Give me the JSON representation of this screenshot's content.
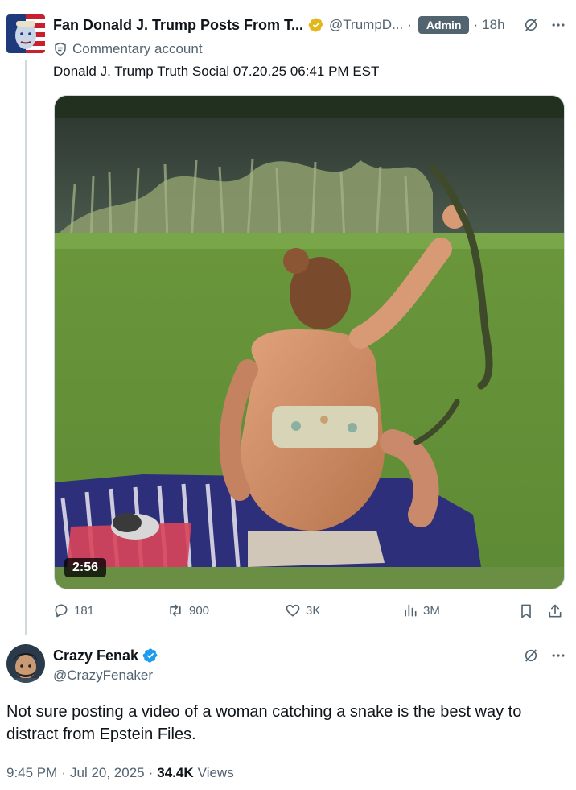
{
  "post": {
    "author_name": "Fan Donald J. Trump Posts From T...",
    "handle": "@TrumpD...",
    "badge": "Admin",
    "time": "18h",
    "account_label": "Commentary account",
    "text": "Donald J. Trump Truth Social 07.20.25 06:41 PM EST",
    "video_duration": "2:56",
    "actions": {
      "replies": "181",
      "reposts": "900",
      "likes": "3K",
      "views": "3M"
    }
  },
  "reply": {
    "author_name": "Crazy Fenak",
    "handle": "@CrazyFenaker",
    "text": "Not sure posting a video of a woman catching a snake is the best way to distract from Epstein Files.",
    "time": "9:45 PM",
    "date": "Jul 20, 2025",
    "views_count": "34.4K",
    "views_label": "Views"
  },
  "icons": [
    "gold-verified-icon",
    "blue-verified-icon",
    "grok-icon",
    "more-icon",
    "reply-icon",
    "repost-icon",
    "like-icon",
    "views-icon",
    "bookmark-icon",
    "share-icon",
    "commentary-icon"
  ],
  "colors": {
    "text_primary": "#0f1419",
    "text_secondary": "#536471",
    "verified_blue": "#1d9bf0",
    "verified_gold": "#e2b719",
    "badge_bg": "#536471"
  }
}
